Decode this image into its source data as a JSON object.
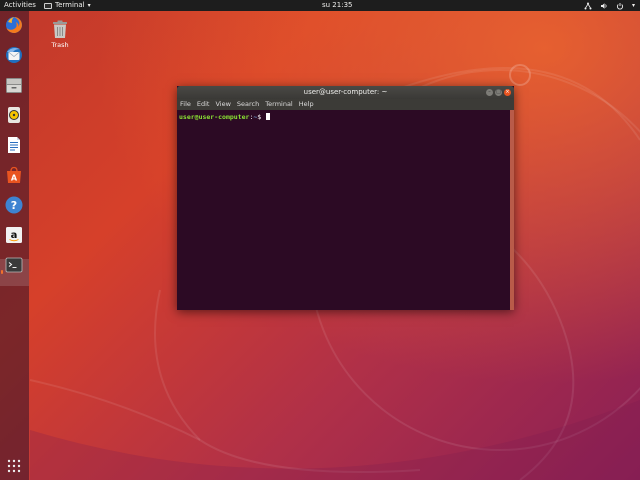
{
  "topbar": {
    "activities_label": "Activities",
    "app_menu_label": "Terminal",
    "clock": "su 21:35"
  },
  "desktop": {
    "trash_label": "Trash"
  },
  "dock": {
    "items": [
      {
        "name": "Firefox",
        "icon": "firefox-icon"
      },
      {
        "name": "Thunderbird",
        "icon": "thunderbird-icon"
      },
      {
        "name": "Files",
        "icon": "files-icon"
      },
      {
        "name": "Rhythmbox",
        "icon": "rhythmbox-icon"
      },
      {
        "name": "LibreOffice Writer",
        "icon": "writer-icon"
      },
      {
        "name": "Ubuntu Software",
        "icon": "software-icon"
      },
      {
        "name": "Help",
        "icon": "help-icon"
      },
      {
        "name": "Amazon",
        "icon": "amazon-icon"
      },
      {
        "name": "Terminal",
        "icon": "terminal-icon",
        "active": true
      }
    ],
    "show_apps_icon": "grid-icon"
  },
  "terminal": {
    "title": "user@user-computer: ~",
    "menu": [
      "File",
      "Edit",
      "View",
      "Search",
      "Terminal",
      "Help"
    ],
    "prompt_user_host": "user@user-computer",
    "prompt_sep": ":",
    "prompt_path": "~",
    "prompt_symbol": "$ "
  },
  "colors": {
    "accent": "#e95420",
    "terminal_bg": "#2c0a24",
    "prompt_green": "#8ae234",
    "prompt_blue": "#729fcf"
  }
}
